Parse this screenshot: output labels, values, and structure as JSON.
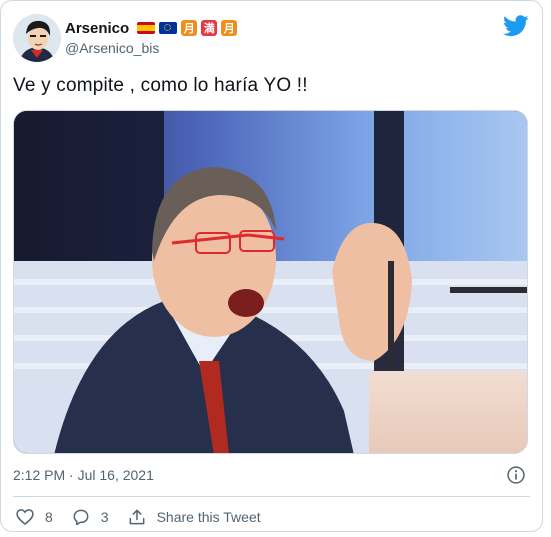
{
  "tweet": {
    "author_name": "Arsenico",
    "author_handle": "@Arsenico_bis",
    "name_badges": [
      "flag-spain-icon",
      "flag-eu-icon",
      "月",
      "満",
      "月"
    ],
    "text": "Ve y compite , como lo haría YO !!",
    "timestamp": "2:12 PM · Jul 16, 2021",
    "likes": "8",
    "replies": "3",
    "share_label": "Share this Tweet"
  },
  "colors": {
    "twitter_blue": "#1d9bf0",
    "text_primary": "#0f1419",
    "text_secondary": "#536471",
    "border": "#cfd9de"
  },
  "icons": [
    "twitter-logo-icon",
    "info-icon",
    "heart-icon",
    "reply-bubble-icon",
    "share-icon"
  ]
}
